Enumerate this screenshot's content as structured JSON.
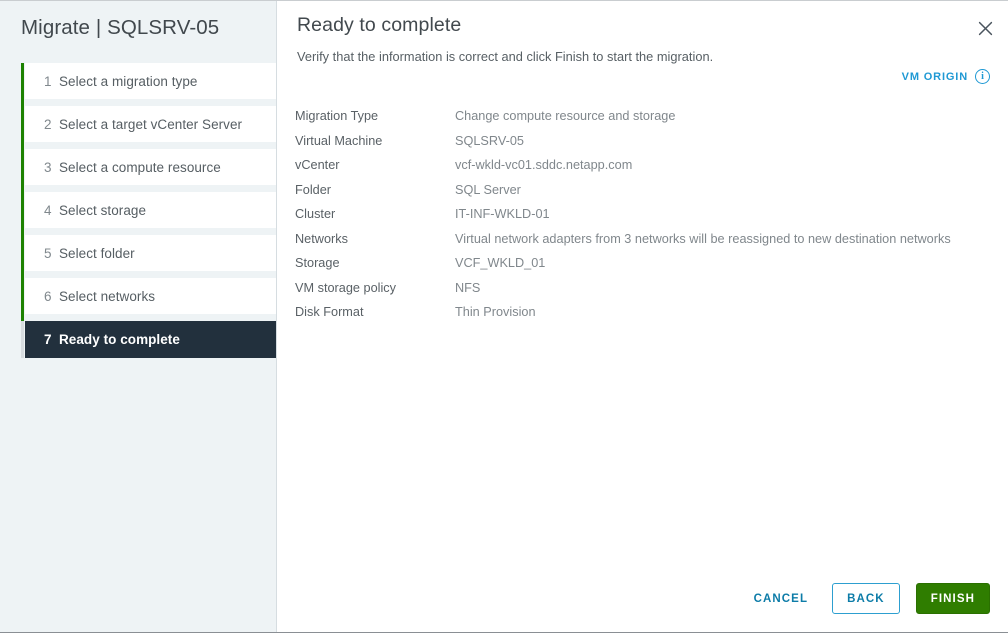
{
  "wizard": {
    "title": "Migrate | SQLSRV-05",
    "close_icon": "close-icon"
  },
  "sidebar": {
    "steps": [
      {
        "num": "1",
        "label": "Select a migration type",
        "active": false
      },
      {
        "num": "2",
        "label": "Select a target vCenter Server",
        "active": false
      },
      {
        "num": "3",
        "label": "Select a compute resource",
        "active": false
      },
      {
        "num": "4",
        "label": "Select storage",
        "active": false
      },
      {
        "num": "5",
        "label": "Select folder",
        "active": false
      },
      {
        "num": "6",
        "label": "Select networks",
        "active": false
      },
      {
        "num": "7",
        "label": "Ready to complete",
        "active": true
      }
    ]
  },
  "content": {
    "title": "Ready to complete",
    "subtitle": "Verify that the information is correct and click Finish to start the migration.",
    "vm_origin": {
      "label": "VM ORIGIN",
      "icon_glyph": "i"
    },
    "details": [
      {
        "label": "Migration Type",
        "value": "Change compute resource and storage"
      },
      {
        "label": "Virtual Machine",
        "value": "SQLSRV-05"
      },
      {
        "label": "vCenter",
        "value": "vcf-wkld-vc01.sddc.netapp.com"
      },
      {
        "label": "Folder",
        "value": "SQL Server"
      },
      {
        "label": "Cluster",
        "value": "IT-INF-WKLD-01"
      },
      {
        "label": "Networks",
        "value": "Virtual network adapters from 3 networks will be reassigned to new destination networks"
      },
      {
        "label": "Storage",
        "value": "VCF_WKLD_01"
      },
      {
        "label": "VM storage policy",
        "value": "NFS"
      },
      {
        "label": "Disk Format",
        "value": "Thin Provision"
      }
    ]
  },
  "footer": {
    "cancel_label": "CANCEL",
    "back_label": "BACK",
    "finish_label": "FINISH"
  },
  "colors": {
    "accent_blue": "#0d7ca8",
    "link_blue": "#1f99d4",
    "progress_green": "#1d8201",
    "finish_green": "#2f7d00",
    "active_step_bg": "#22303d",
    "sidebar_bg": "#eef3f5"
  }
}
